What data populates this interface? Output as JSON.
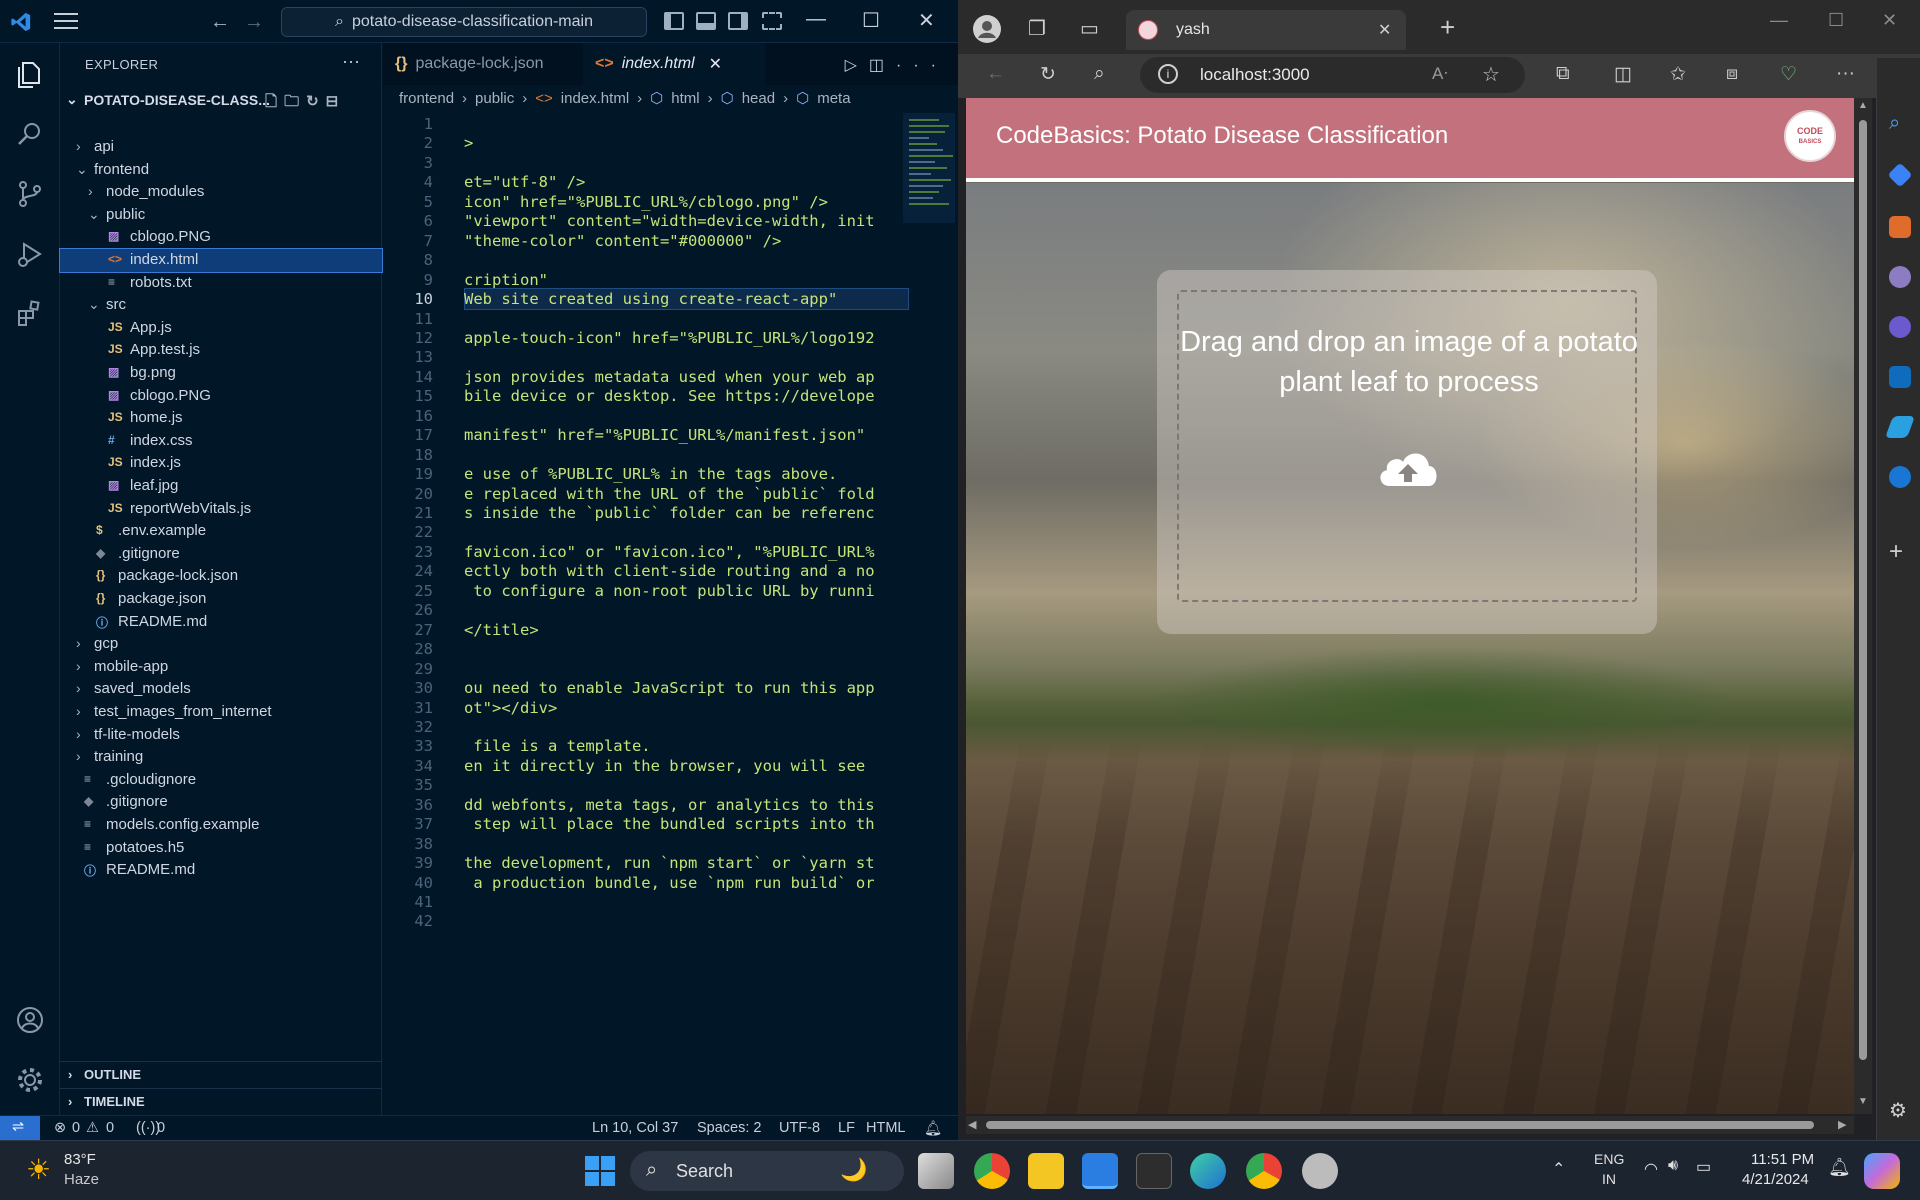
{
  "vscode": {
    "command_center": "potato-disease-classification-main",
    "explorer_title": "EXPLORER",
    "project_name": "POTATO-DISEASE-CLASS...",
    "tree": [
      {
        "label": "api",
        "type": "folder",
        "open": false,
        "depth": 0
      },
      {
        "label": "frontend",
        "type": "folder",
        "open": true,
        "depth": 0
      },
      {
        "label": "node_modules",
        "type": "folder",
        "open": false,
        "depth": 1
      },
      {
        "label": "public",
        "type": "folder",
        "open": true,
        "depth": 1
      },
      {
        "label": "cblogo.PNG",
        "type": "img",
        "depth": 2
      },
      {
        "label": "index.html",
        "type": "html",
        "depth": 2,
        "selected": true
      },
      {
        "label": "robots.txt",
        "type": "txt",
        "depth": 2
      },
      {
        "label": "src",
        "type": "folder",
        "open": true,
        "depth": 1
      },
      {
        "label": "App.js",
        "type": "js",
        "depth": 2
      },
      {
        "label": "App.test.js",
        "type": "js",
        "depth": 2
      },
      {
        "label": "bg.png",
        "type": "img",
        "depth": 2
      },
      {
        "label": "cblogo.PNG",
        "type": "img",
        "depth": 2
      },
      {
        "label": "home.js",
        "type": "js",
        "depth": 2
      },
      {
        "label": "index.css",
        "type": "css",
        "depth": 2
      },
      {
        "label": "index.js",
        "type": "js",
        "depth": 2
      },
      {
        "label": "leaf.jpg",
        "type": "img",
        "depth": 2
      },
      {
        "label": "reportWebVitals.js",
        "type": "js",
        "depth": 2
      },
      {
        "label": ".env.example",
        "type": "env",
        "depth": 1
      },
      {
        "label": ".gitignore",
        "type": "git",
        "depth": 1
      },
      {
        "label": "package-lock.json",
        "type": "json",
        "depth": 1
      },
      {
        "label": "package.json",
        "type": "json",
        "depth": 1
      },
      {
        "label": "README.md",
        "type": "info",
        "depth": 1
      },
      {
        "label": "gcp",
        "type": "folder",
        "open": false,
        "depth": 0
      },
      {
        "label": "mobile-app",
        "type": "folder",
        "open": false,
        "depth": 0
      },
      {
        "label": "saved_models",
        "type": "folder",
        "open": false,
        "depth": 0
      },
      {
        "label": "test_images_from_internet",
        "type": "folder",
        "open": false,
        "depth": 0
      },
      {
        "label": "tf-lite-models",
        "type": "folder",
        "open": false,
        "depth": 0
      },
      {
        "label": "training",
        "type": "folder",
        "open": false,
        "depth": 0
      },
      {
        "label": ".gcloudignore",
        "type": "txt",
        "depth": 0
      },
      {
        "label": ".gitignore",
        "type": "git",
        "depth": 0
      },
      {
        "label": "models.config.example",
        "type": "txt",
        "depth": 0
      },
      {
        "label": "potatoes.h5",
        "type": "txt",
        "depth": 0
      },
      {
        "label": "README.md",
        "type": "info",
        "depth": 0
      }
    ],
    "outline_label": "OUTLINE",
    "timeline_label": "TIMELINE",
    "tabs": [
      {
        "label": "package-lock.json",
        "icon": "{}",
        "active": false
      },
      {
        "label": "index.html",
        "icon": "<>",
        "active": true
      }
    ],
    "breadcrumb": [
      "frontend",
      "public",
      "index.html",
      "html",
      "head",
      "meta"
    ],
    "current_line": 10,
    "code_lines": [
      {
        "n": 1,
        "t": ""
      },
      {
        "n": 2,
        "t": ">"
      },
      {
        "n": 3,
        "t": ""
      },
      {
        "n": 4,
        "t": "et=\"utf-8\" />"
      },
      {
        "n": 5,
        "t": "icon\" href=\"%PUBLIC_URL%/cblogo.png\" />"
      },
      {
        "n": 6,
        "t": "\"viewport\" content=\"width=device-width, init"
      },
      {
        "n": 7,
        "t": "\"theme-color\" content=\"#000000\" />"
      },
      {
        "n": 8,
        "t": ""
      },
      {
        "n": 9,
        "t": "cription\""
      },
      {
        "n": 10,
        "t": "Web site created using create-react-app\""
      },
      {
        "n": 11,
        "t": ""
      },
      {
        "n": 12,
        "t": "apple-touch-icon\" href=\"%PUBLIC_URL%/logo192"
      },
      {
        "n": 13,
        "t": ""
      },
      {
        "n": 14,
        "t": "json provides metadata used when your web ap"
      },
      {
        "n": 15,
        "t": "bile device or desktop. See https://develope"
      },
      {
        "n": 16,
        "t": ""
      },
      {
        "n": 17,
        "t": "manifest\" href=\"%PUBLIC_URL%/manifest.json\""
      },
      {
        "n": 18,
        "t": ""
      },
      {
        "n": 19,
        "t": "e use of %PUBLIC_URL% in the tags above."
      },
      {
        "n": 20,
        "t": "e replaced with the URL of the `public` fold"
      },
      {
        "n": 21,
        "t": "s inside the `public` folder can be referenc"
      },
      {
        "n": 22,
        "t": ""
      },
      {
        "n": 23,
        "t": "favicon.ico\" or \"favicon.ico\", \"%PUBLIC_URL%"
      },
      {
        "n": 24,
        "t": "ectly both with client-side routing and a no"
      },
      {
        "n": 25,
        "t": " to configure a non-root public URL by runni"
      },
      {
        "n": 26,
        "t": ""
      },
      {
        "n": 27,
        "t": "</title>"
      },
      {
        "n": 28,
        "t": ""
      },
      {
        "n": 29,
        "t": ""
      },
      {
        "n": 30,
        "t": "ou need to enable JavaScript to run this app"
      },
      {
        "n": 31,
        "t": "ot\"></div>"
      },
      {
        "n": 32,
        "t": ""
      },
      {
        "n": 33,
        "t": " file is a template."
      },
      {
        "n": 34,
        "t": "en it directly in the browser, you will see "
      },
      {
        "n": 35,
        "t": ""
      },
      {
        "n": 36,
        "t": "dd webfonts, meta tags, or analytics to this"
      },
      {
        "n": 37,
        "t": " step will place the bundled scripts into th"
      },
      {
        "n": 38,
        "t": ""
      },
      {
        "n": 39,
        "t": "the development, run `npm start` or `yarn st"
      },
      {
        "n": 40,
        "t": " a production bundle, use `npm run build` or"
      },
      {
        "n": 41,
        "t": ""
      },
      {
        "n": 42,
        "t": ""
      }
    ],
    "status": {
      "errors": "0",
      "warnings": "0",
      "ports": "0",
      "cursor": "Ln 10, Col 37",
      "spaces": "Spaces: 2",
      "encoding": "UTF-8",
      "eol": "LF",
      "language": "HTML"
    }
  },
  "edge": {
    "tab_title": "yash",
    "url": "localhost:3000",
    "page": {
      "header_title": "CodeBasics: Potato Disease Classification",
      "logo_text_top": "CODE",
      "logo_text_bottom": "BASICS",
      "drop_text": "Drag and drop an image of a potato plant leaf to process"
    }
  },
  "taskbar": {
    "weather_temp": "83°F",
    "weather_desc": "Haze",
    "search_label": "Search",
    "lang_top": "ENG",
    "lang_bottom": "IN",
    "time": "11:51 PM",
    "date": "4/21/2024"
  }
}
